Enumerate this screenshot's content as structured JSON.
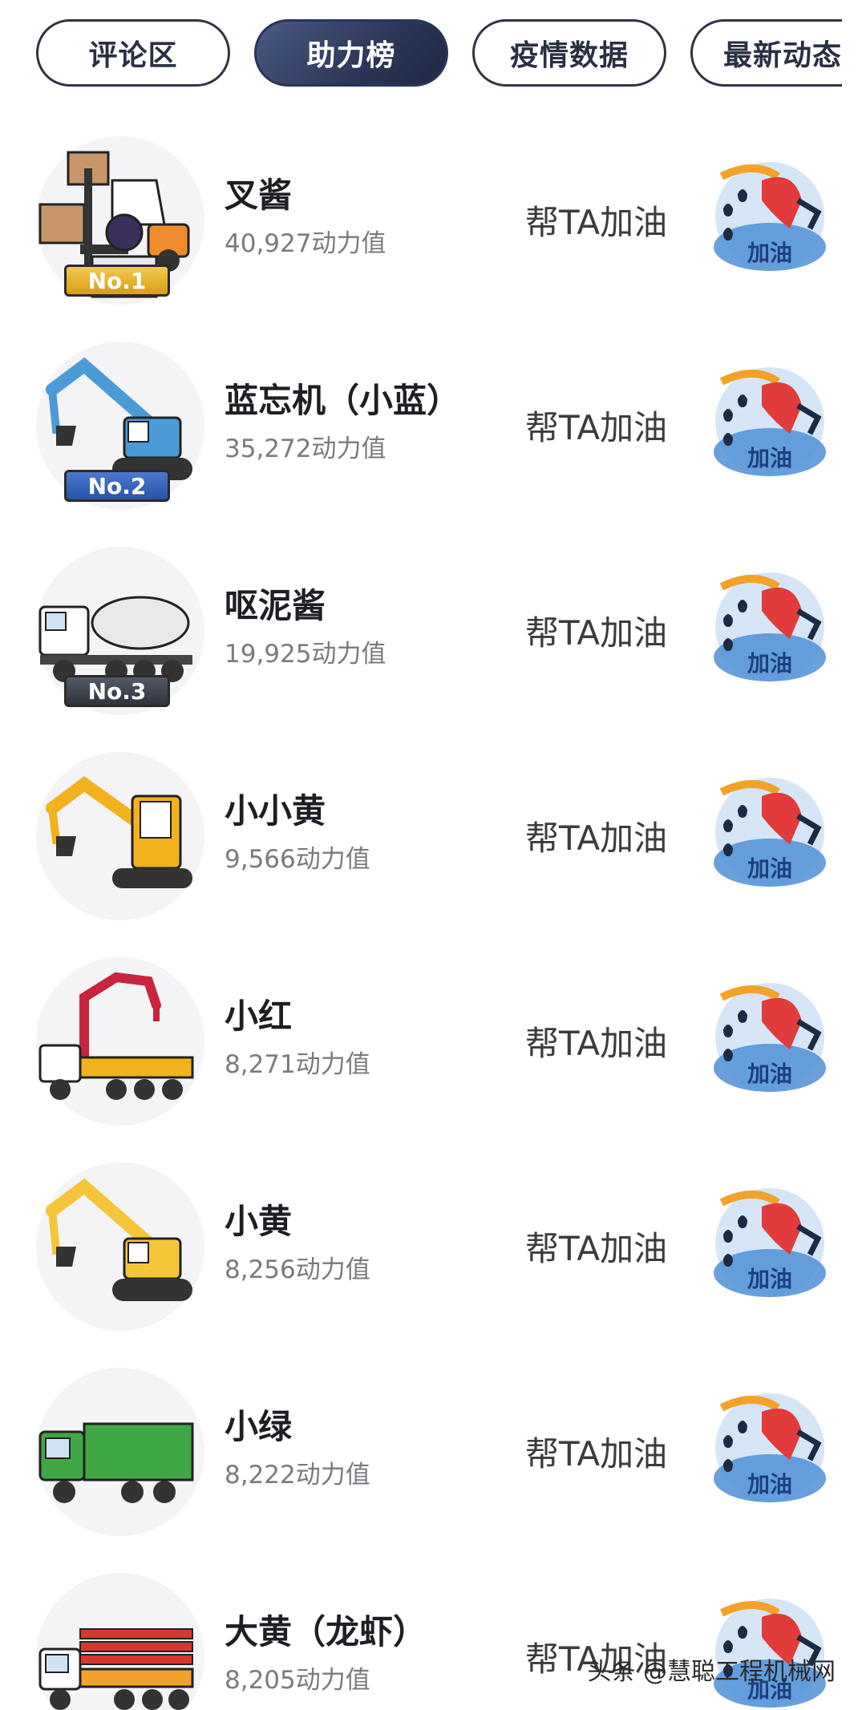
{
  "tabs": [
    {
      "label": "评论区",
      "active": false
    },
    {
      "label": "助力榜",
      "active": true
    },
    {
      "label": "疫情数据",
      "active": false
    },
    {
      "label": "最新动态",
      "active": false
    }
  ],
  "list": [
    {
      "name": "叉酱",
      "score": "40,927动力值",
      "rank": "No.1",
      "vehicle": "forklift-icon",
      "color": "#f08c2e"
    },
    {
      "name": "蓝忘机（小蓝）",
      "score": "35,272动力值",
      "rank": "No.2",
      "vehicle": "excavator-icon",
      "color": "#4b9bd9"
    },
    {
      "name": "呕泥酱",
      "score": "19,925动力值",
      "rank": "No.3",
      "vehicle": "concrete-mixer-icon",
      "color": "#e9e9ec"
    },
    {
      "name": "小小黄",
      "score": "9,566动力值",
      "rank": "",
      "vehicle": "mini-excavator-icon",
      "color": "#f2b21d"
    },
    {
      "name": "小红",
      "score": "8,271动力值",
      "rank": "",
      "vehicle": "pump-truck-icon",
      "color": "#c8233f"
    },
    {
      "name": "小黄",
      "score": "8,256动力值",
      "rank": "",
      "vehicle": "excavator-icon",
      "color": "#f5c63a"
    },
    {
      "name": "小绿",
      "score": "8,222动力值",
      "rank": "",
      "vehicle": "dump-truck-icon",
      "color": "#3fa845"
    },
    {
      "name": "大黄（龙虾）",
      "score": "8,205动力值",
      "rank": "",
      "vehicle": "boom-truck-icon",
      "color": "#d9362d"
    }
  ],
  "help_label": "帮TA加油",
  "fuel_label": "加油",
  "watermark": "头条 @慧聪工程机械网"
}
